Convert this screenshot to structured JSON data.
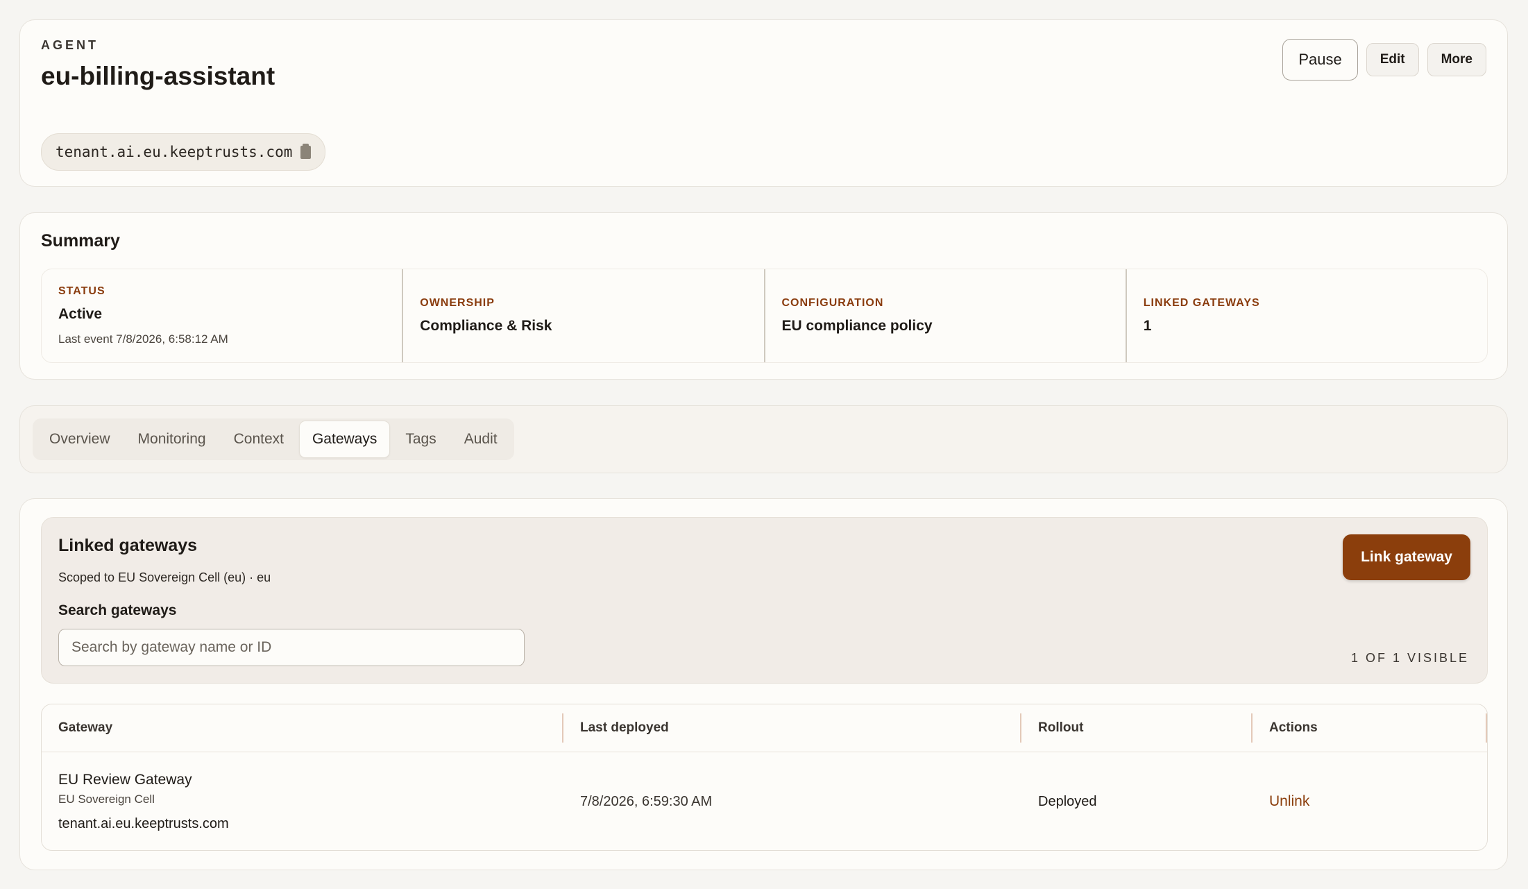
{
  "header": {
    "eyebrow": "AGENT",
    "title": "eu-billing-assistant",
    "host": "tenant.ai.eu.keeptrusts.com",
    "actions": {
      "pause": "Pause",
      "edit": "Edit",
      "more": "More"
    }
  },
  "summary": {
    "title": "Summary",
    "status": {
      "label": "STATUS",
      "value": "Active",
      "sub": "Last event 7/8/2026, 6:58:12 AM"
    },
    "ownership": {
      "label": "OWNERSHIP",
      "value": "Compliance & Risk"
    },
    "configuration": {
      "label": "CONFIGURATION",
      "value": "EU compliance policy"
    },
    "linked_gateways": {
      "label": "LINKED GATEWAYS",
      "value": "1"
    }
  },
  "tabs": [
    "Overview",
    "Monitoring",
    "Context",
    "Gateways",
    "Tags",
    "Audit"
  ],
  "active_tab": "Gateways",
  "gateways": {
    "title": "Linked gateways",
    "scope": "Scoped to EU Sovereign Cell (eu) · eu",
    "search_label": "Search gateways",
    "search_placeholder": "Search by gateway name or ID",
    "search_value": "",
    "link_button": "Link gateway",
    "visible_count": "1 OF 1 VISIBLE",
    "columns": [
      "Gateway",
      "Last deployed",
      "Rollout",
      "Actions"
    ],
    "rows": [
      {
        "name": "EU Review Gateway",
        "cell": "EU Sovereign Cell",
        "host": "tenant.ai.eu.keeptrusts.com",
        "last_deployed": "7/8/2026, 6:59:30 AM",
        "rollout": "Deployed",
        "action": "Unlink"
      }
    ]
  },
  "colors": {
    "accent": "#8b3e0c",
    "background": "#f6f5f2",
    "card": "#fdfcf9"
  }
}
